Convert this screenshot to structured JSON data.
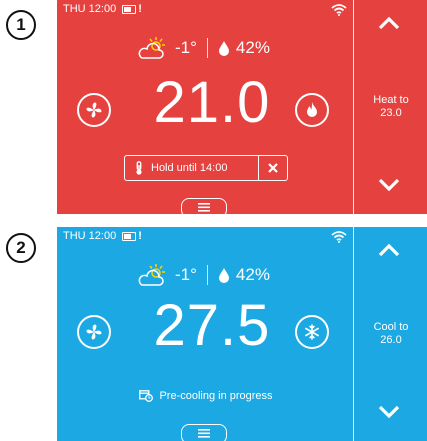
{
  "colors": {
    "heat": "#E5413F",
    "cool": "#1CA9E3",
    "white": "#ffffff"
  },
  "screens": [
    {
      "badge": "1",
      "status": {
        "time": "THU 12:00",
        "battery_icon": "battery-alert-icon",
        "wifi_icon": "wifi-icon"
      },
      "weather": {
        "icon": "partly-sunny-icon",
        "outdoor_temp": "-1°",
        "humidity": "42%"
      },
      "setpoint_current": "21.0",
      "left_button_icon": "fan-icon",
      "right_button_icon": "flame-icon",
      "hold": {
        "text": "Hold until 14:00"
      },
      "side": {
        "line1": "Heat to",
        "line2": "23.0"
      }
    },
    {
      "badge": "2",
      "status": {
        "time": "THU 12:00",
        "battery_icon": "battery-alert-icon",
        "wifi_icon": "wifi-icon"
      },
      "weather": {
        "icon": "partly-sunny-icon",
        "outdoor_temp": "-1°",
        "humidity": "42%"
      },
      "setpoint_current": "27.5",
      "left_button_icon": "fan-icon",
      "right_button_icon": "snowflake-icon",
      "message": "Pre-cooling in progress",
      "side": {
        "line1": "Cool to",
        "line2": "26.0"
      }
    }
  ]
}
